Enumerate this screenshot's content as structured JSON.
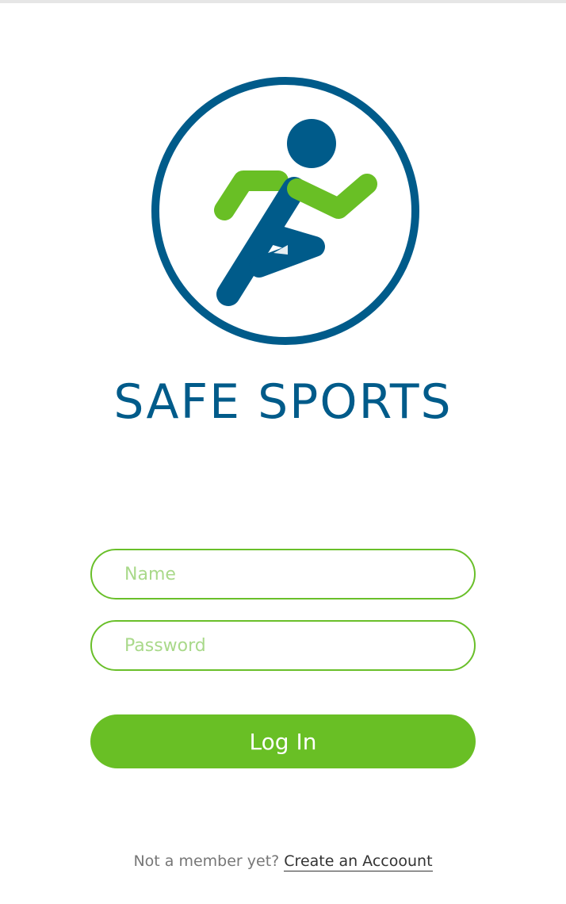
{
  "app": {
    "title": "SAFE SPORTS",
    "logo_icon": "running-athlete-icon"
  },
  "form": {
    "name_placeholder": "Name",
    "password_placeholder": "Password",
    "login_label": "Log In"
  },
  "footer": {
    "prompt": "Not a member yet? ",
    "create_account_label": "Create an Accoount"
  },
  "colors": {
    "brand_blue": "#005b8a",
    "brand_green": "#69bf25",
    "placeholder_green": "#a9d98a",
    "background": "#ffffff"
  }
}
